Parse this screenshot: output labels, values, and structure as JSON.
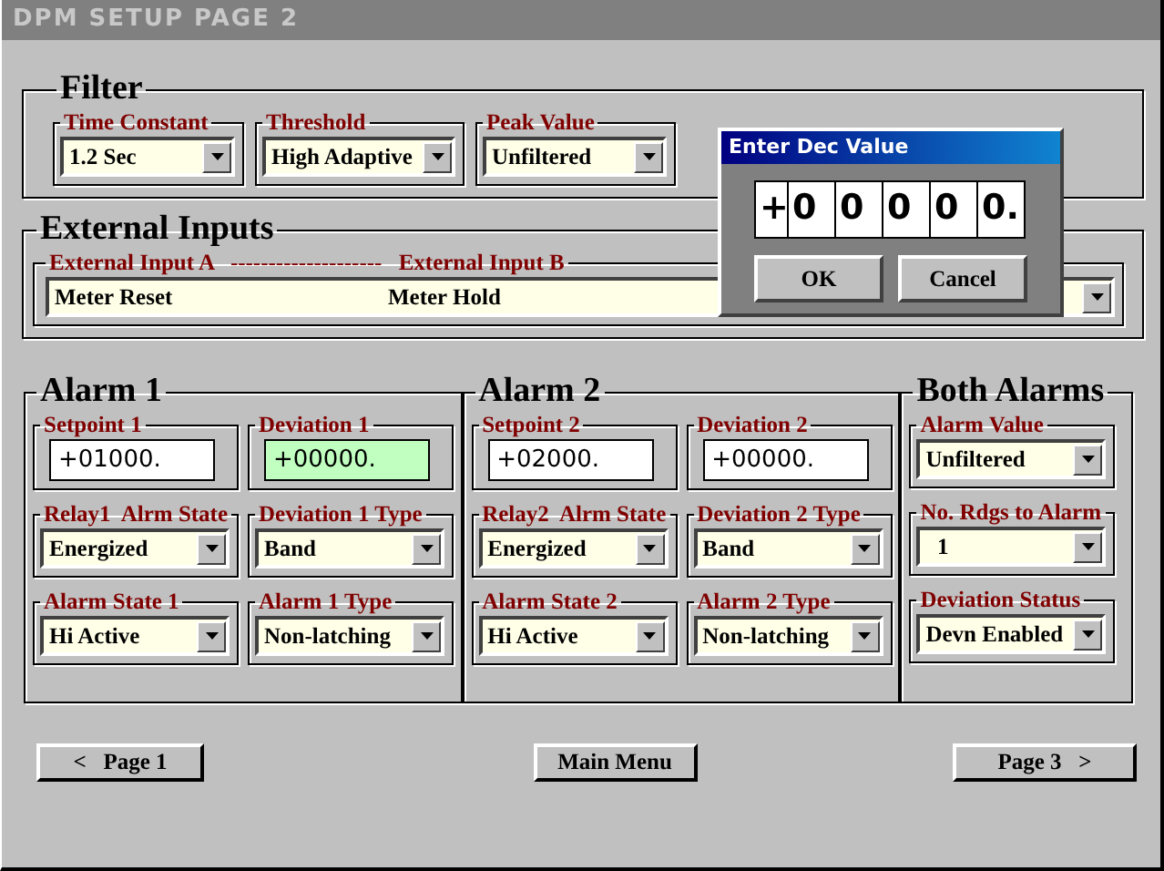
{
  "window": {
    "title": "DPM SETUP  PAGE  2"
  },
  "filter": {
    "title": "Filter",
    "fields": [
      {
        "label": "Time Constant",
        "value": "1.2 Sec",
        "kind": "dropdown"
      },
      {
        "label": "Threshold",
        "value": "High Adaptive",
        "kind": "dropdown"
      },
      {
        "label": "Peak Value",
        "value": "Unfiltered",
        "kind": "dropdown"
      }
    ]
  },
  "external_inputs": {
    "title": "External Inputs",
    "label_a": "External Input A",
    "separator": "--------------------",
    "label_b": "External Input B",
    "value_a": "Meter Reset",
    "value_b": "Meter Hold"
  },
  "alarm_groups": [
    {
      "title": "Alarm 1",
      "kind": "two_column",
      "fields": [
        {
          "label": "Setpoint 1",
          "value": "+01000.",
          "kind": "entry",
          "selected": false
        },
        {
          "label": "Deviation 1",
          "value": "+00000.",
          "kind": "entry",
          "selected": true
        },
        {
          "label": "Relay1  Alrm State",
          "value": "Energized",
          "kind": "dropdown"
        },
        {
          "label": "Deviation 1 Type",
          "value": "Band",
          "kind": "dropdown"
        },
        {
          "label": "Alarm State 1",
          "value": "Hi Active",
          "kind": "dropdown"
        },
        {
          "label": "Alarm 1 Type",
          "value": "Non-latching",
          "kind": "dropdown"
        }
      ]
    },
    {
      "title": "Alarm 2",
      "kind": "two_column",
      "fields": [
        {
          "label": "Setpoint 2",
          "value": "+02000.",
          "kind": "entry",
          "selected": false
        },
        {
          "label": "Deviation 2",
          "value": "+00000.",
          "kind": "entry",
          "selected": false
        },
        {
          "label": "Relay2  Alrm State",
          "value": "Energized",
          "kind": "dropdown"
        },
        {
          "label": "Deviation 2 Type",
          "value": "Band",
          "kind": "dropdown"
        },
        {
          "label": "Alarm State 2",
          "value": "Hi Active",
          "kind": "dropdown"
        },
        {
          "label": "Alarm 2 Type",
          "value": "Non-latching",
          "kind": "dropdown"
        }
      ]
    },
    {
      "title": "Both Alarms",
      "kind": "one_column",
      "fields": [
        {
          "label": "Alarm Value",
          "value": "Unfiltered",
          "kind": "dropdown"
        },
        {
          "label": "No. Rdgs to Alarm",
          "value": "  1",
          "kind": "dropdown"
        },
        {
          "label": "Deviation Status",
          "value": "Devn Enabled",
          "kind": "dropdown"
        }
      ]
    }
  ],
  "nav": {
    "prev": {
      "arrow": "<",
      "label": "Page 1"
    },
    "main": "Main Menu",
    "next": {
      "label": "Page 3",
      "arrow": ">"
    }
  },
  "dialog": {
    "title": "Enter Dec Value",
    "digits": [
      "+",
      "0",
      "0",
      "0",
      "0",
      "0."
    ],
    "buttons": [
      "OK",
      "Cancel"
    ]
  }
}
